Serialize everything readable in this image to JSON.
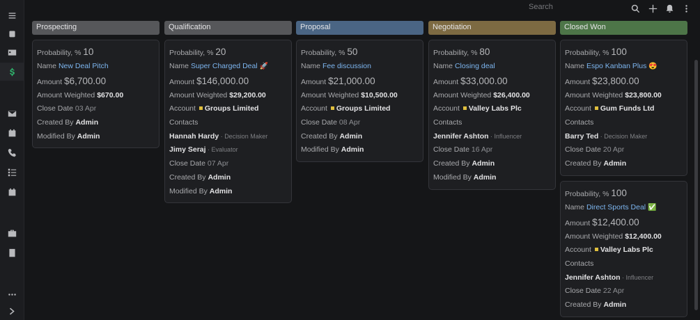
{
  "topbar": {
    "search_placeholder": "Search"
  },
  "sidebar": {
    "items": [
      {
        "icon": "menu-icon"
      },
      {
        "icon": "building-icon"
      },
      {
        "icon": "contact-card-icon"
      },
      {
        "icon": "dollar-icon",
        "active": true
      },
      {
        "icon": "envelope-icon"
      },
      {
        "icon": "calendar-check-icon"
      },
      {
        "icon": "phone-icon"
      },
      {
        "icon": "tasks-icon"
      },
      {
        "icon": "calendar-icon"
      },
      {
        "icon": "briefcase-icon"
      },
      {
        "icon": "book-icon"
      },
      {
        "icon": "more-icon"
      },
      {
        "icon": "chevron-right-icon"
      }
    ]
  },
  "columns": [
    {
      "title": "Prospecting",
      "color": "#56575a",
      "cards": [
        {
          "probability": "10",
          "name": "New Deal Pitch",
          "name_emoji": "",
          "amount": "$6,700.00",
          "amount_weighted": "$670.00",
          "close_date": "03 Apr",
          "created_by": "Admin",
          "modified_by": "Admin"
        }
      ]
    },
    {
      "title": "Qualification",
      "color": "#56575a",
      "cards": [
        {
          "probability": "20",
          "name": "Super Charged Deal",
          "name_emoji": "🚀",
          "amount": "$146,000.00",
          "amount_weighted": "$29,200.00",
          "account": "Groups Limited",
          "contacts": [
            {
              "name": "Hannah Hardy",
              "role": "Decision Maker"
            },
            {
              "name": "Jimy Seraj",
              "role": "Evaluator"
            }
          ],
          "close_date": "07 Apr",
          "created_by": "Admin",
          "modified_by": "Admin"
        }
      ]
    },
    {
      "title": "Proposal",
      "color": "#4a6584",
      "cards": [
        {
          "probability": "50",
          "name": "Fee discussion",
          "name_emoji": "",
          "amount": "$21,000.00",
          "amount_weighted": "$10,500.00",
          "account": "Groups Limited",
          "close_date": "08 Apr",
          "created_by": "Admin",
          "modified_by": "Admin"
        }
      ]
    },
    {
      "title": "Negotiation",
      "color": "#7d6a42",
      "cards": [
        {
          "probability": "80",
          "name": "Closing deal",
          "name_emoji": "",
          "amount": "$33,000.00",
          "amount_weighted": "$26,400.00",
          "account": "Valley Labs Plc",
          "contacts": [
            {
              "name": "Jennifer Ashton",
              "role": "Influencer"
            }
          ],
          "close_date": "16 Apr",
          "created_by": "Admin",
          "modified_by": "Admin"
        }
      ]
    },
    {
      "title": "Closed Won",
      "color": "#4d7548",
      "cards": [
        {
          "probability": "100",
          "name": "Espo Kanban Plus",
          "name_emoji": "😍",
          "amount": "$23,800.00",
          "amount_weighted": "$23,800.00",
          "account": "Gum Funds Ltd",
          "contacts": [
            {
              "name": "Barry Ted",
              "role": "Decision Maker"
            }
          ],
          "close_date": "20 Apr",
          "created_by": "Admin"
        },
        {
          "probability": "100",
          "name": "Direct Sports Deal",
          "name_emoji": "✅",
          "amount": "$12,400.00",
          "amount_weighted": "$12,400.00",
          "account": "Valley Labs Plc",
          "contacts": [
            {
              "name": "Jennifer Ashton",
              "role": "Influencer"
            }
          ],
          "close_date": "22 Apr",
          "created_by": "Admin"
        }
      ]
    }
  ],
  "labels": {
    "probability": "Probability, %",
    "name": "Name",
    "amount": "Amount",
    "amount_weighted": "Amount Weighted",
    "account": "Account",
    "contacts": "Contacts",
    "close_date": "Close Date",
    "created_by": "Created By",
    "modified_by": "Modified By"
  }
}
